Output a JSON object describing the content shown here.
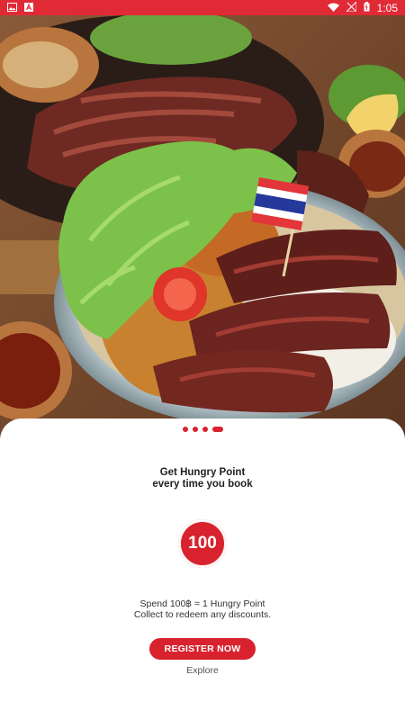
{
  "status_bar": {
    "time": "1:05",
    "left_icons": [
      "image-icon",
      "a-icon"
    ],
    "right_icons": [
      "wifi-icon",
      "no-signal-icon",
      "battery-icon"
    ],
    "color": "#e02a36"
  },
  "hero": {
    "image": "food-photo",
    "flag": "thai-flag"
  },
  "pager": {
    "count": 4,
    "active_index": 3,
    "color": "#d8232f"
  },
  "content": {
    "headline_line1": "Get Hungry Point",
    "headline_line2": "every time you book",
    "points_badge": "100",
    "desc_line1": "Spend 100฿ = 1 Hungry Point",
    "desc_line2": "Collect to redeem any discounts.",
    "register_label": "REGISTER NOW",
    "explore_label": "Explore"
  },
  "colors": {
    "accent": "#d8232f"
  }
}
